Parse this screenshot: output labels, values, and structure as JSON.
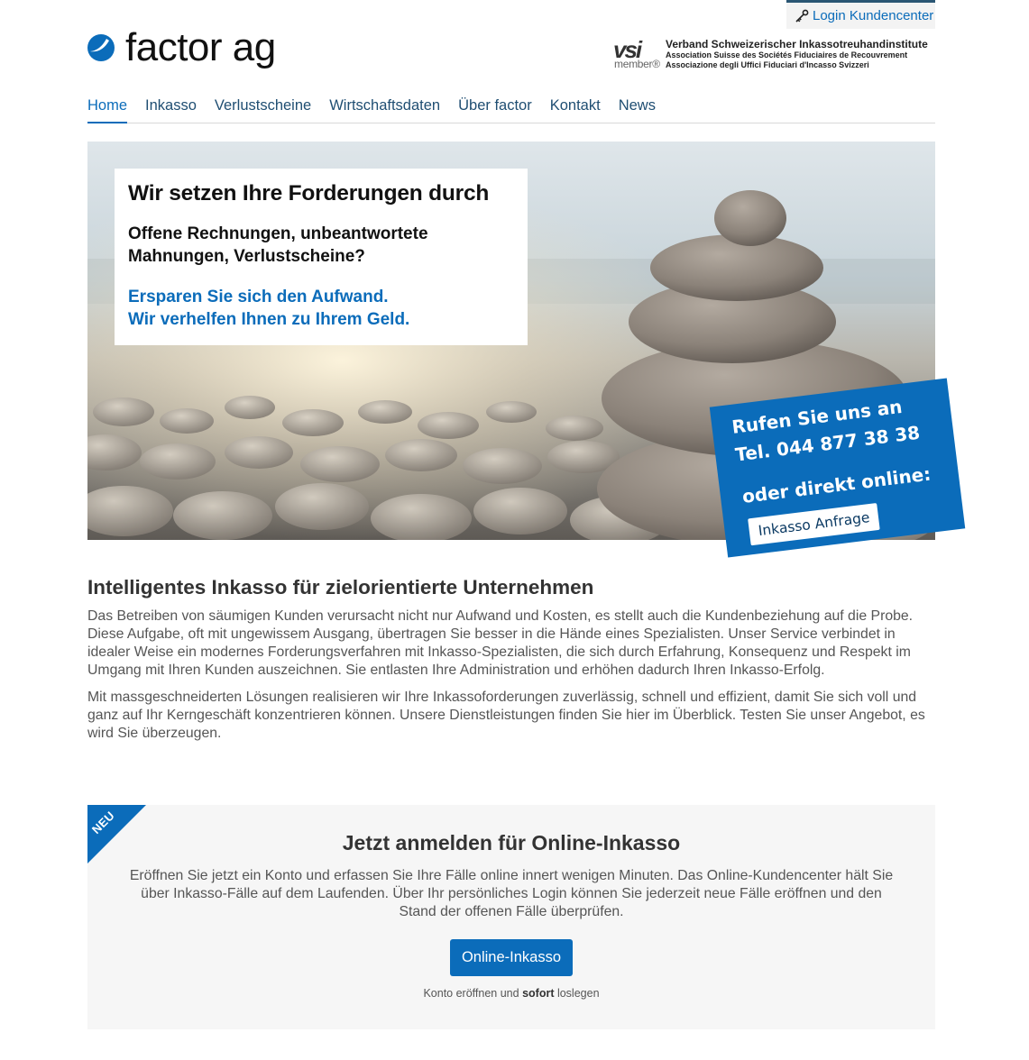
{
  "header": {
    "login_label": "Login Kundencenter",
    "logo_text": "factor ag",
    "vsi": {
      "mark": "vsi",
      "member": "member®",
      "line1": "Verband Schweizerischer Inkassotreuhandinstitute",
      "line2": "Association Suisse des Sociétés Fiduciaires de Recouvrement",
      "line3": "Associazione degli Uffici Fiduciari d'Incasso Svizzeri"
    }
  },
  "nav": {
    "items": [
      {
        "label": "Home",
        "active": true
      },
      {
        "label": "Inkasso"
      },
      {
        "label": "Verlustscheine"
      },
      {
        "label": "Wirtschaftsdaten"
      },
      {
        "label": "Über factor"
      },
      {
        "label": "Kontakt"
      },
      {
        "label": "News"
      }
    ]
  },
  "hero": {
    "title": "Wir setzen Ihre Forderungen durch",
    "question": "Offene Rechnungen, unbeantwortete Mahnungen, Verlustscheine?",
    "answer_line1": "Ersparen Sie sich den Aufwand.",
    "answer_line2": "Wir verhelfen Ihnen zu Ihrem Geld."
  },
  "callout": {
    "line1": "Rufen Sie uns an",
    "line2": "Tel. 044 877 38 38",
    "line3": "oder direkt online:",
    "button": "Inkasso Anfrage"
  },
  "intro": {
    "heading": "Intelligentes Inkasso für zielorientierte Unternehmen",
    "p1": "Das Betreiben von säumigen Kunden verursacht nicht nur Aufwand und Kosten, es stellt auch die Kundenbeziehung auf die Probe. Diese Aufgabe, oft mit ungewissem Ausgang, übertragen Sie besser in die Hände eines Spezialisten. Unser Service verbindet in idealer Weise ein modernes Forderungsverfahren mit Inkasso-Spezialisten, die sich durch Erfahrung, Konsequenz und Respekt im Umgang mit Ihren Kunden auszeichnen. Sie entlasten Ihre Administration und erhöhen dadurch Ihren Inkasso-Erfolg.",
    "p2": "Mit massgeschneiderten Lösungen realisieren wir Ihre Inkassoforderungen zuverlässig, schnell und effizient, damit Sie sich voll und ganz auf Ihr Kerngeschäft konzentrieren können. Unsere Dienstleistungen finden Sie hier im Überblick. Testen Sie unser Angebot, es wird Sie überzeugen."
  },
  "register": {
    "ribbon": "NEU",
    "heading": "Jetzt anmelden für Online-Inkasso",
    "text": "Eröffnen Sie jetzt ein Konto und erfassen Sie Ihre Fälle online innert wenigen Minuten. Das Online-Kundencenter hält Sie über Inkasso-Fälle auf dem Laufenden. Über Ihr persönliches Login können Sie jederzeit neue Fälle eröffnen und den Stand der offenen Fälle überprüfen.",
    "button": "Online-Inkasso",
    "note_pre": "Konto eröffnen und ",
    "note_bold": "sofort",
    "note_post": " loslegen"
  },
  "colors": {
    "brand_blue": "#0b6cba",
    "nav_text": "#1f4e72",
    "panel_bg": "#f6f6f6"
  }
}
